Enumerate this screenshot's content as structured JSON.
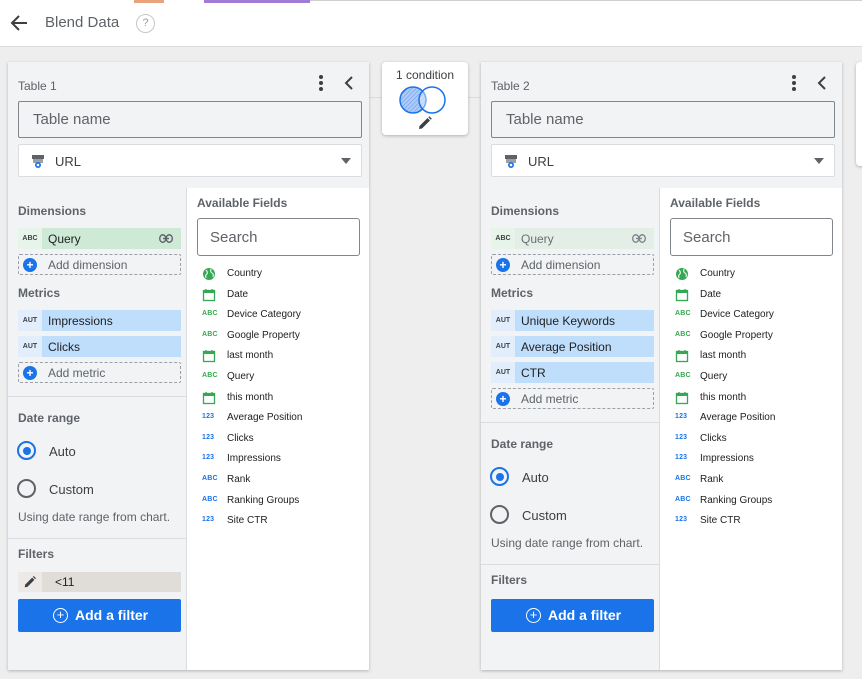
{
  "header": {
    "title": "Blend Data",
    "help": "?"
  },
  "colors": {
    "accent": "#1a73e8",
    "dimension": "#ceead6",
    "metric": "#bfdefc",
    "panel_bg": "#f1f3f4"
  },
  "condition": {
    "label": "1 condition"
  },
  "tables": [
    {
      "label": "Table 1",
      "name_placeholder": "Table name",
      "source": "URL",
      "dimensions_title": "Dimensions",
      "dimensions": [
        {
          "type": "ABC",
          "name": "Query"
        }
      ],
      "add_dimension": "Add dimension",
      "metrics_title": "Metrics",
      "metrics": [
        {
          "type": "AUT",
          "name": "Impressions"
        },
        {
          "type": "AUT",
          "name": "Clicks"
        }
      ],
      "add_metric": "Add metric",
      "date_range_title": "Date range",
      "date_auto": "Auto",
      "date_custom": "Custom",
      "date_selected": "Auto",
      "date_note": "Using date range from chart.",
      "filters_title": "Filters",
      "filters": [
        "<11"
      ],
      "add_filter": "Add a filter",
      "available_title": "Available Fields",
      "search_placeholder": "Search",
      "fields": [
        {
          "type": "geo",
          "name": "Country"
        },
        {
          "type": "date",
          "name": "Date"
        },
        {
          "type": "ABC",
          "name": "Device Category"
        },
        {
          "type": "ABC",
          "name": "Google Property"
        },
        {
          "type": "date",
          "name": "last month"
        },
        {
          "type": "ABC",
          "name": "Query"
        },
        {
          "type": "date",
          "name": "this month"
        },
        {
          "type": "123",
          "name": "Average Position"
        },
        {
          "type": "123",
          "name": "Clicks"
        },
        {
          "type": "123",
          "name": "Impressions"
        },
        {
          "type": "ABC",
          "name": "Rank"
        },
        {
          "type": "ABC",
          "name": "Ranking Groups"
        },
        {
          "type": "123",
          "name": "Site CTR"
        }
      ]
    },
    {
      "label": "Table 2",
      "name_placeholder": "Table name",
      "source": "URL",
      "dimensions_title": "Dimensions",
      "dimensions": [
        {
          "type": "ABC",
          "name": "Query"
        }
      ],
      "add_dimension": "Add dimension",
      "metrics_title": "Metrics",
      "metrics": [
        {
          "type": "AUT",
          "name": "Unique Keywords"
        },
        {
          "type": "AUT",
          "name": "Average Position"
        },
        {
          "type": "AUT",
          "name": "CTR"
        }
      ],
      "add_metric": "Add metric",
      "date_range_title": "Date range",
      "date_auto": "Auto",
      "date_custom": "Custom",
      "date_selected": "Auto",
      "date_note": "Using date range from chart.",
      "filters_title": "Filters",
      "filters": [],
      "add_filter": "Add a filter",
      "available_title": "Available Fields",
      "search_placeholder": "Search",
      "fields": [
        {
          "type": "geo",
          "name": "Country"
        },
        {
          "type": "date",
          "name": "Date"
        },
        {
          "type": "ABC",
          "name": "Device Category"
        },
        {
          "type": "ABC",
          "name": "Google Property"
        },
        {
          "type": "date",
          "name": "last month"
        },
        {
          "type": "ABC",
          "name": "Query"
        },
        {
          "type": "date",
          "name": "this month"
        },
        {
          "type": "123",
          "name": "Average Position"
        },
        {
          "type": "123",
          "name": "Clicks"
        },
        {
          "type": "123",
          "name": "Impressions"
        },
        {
          "type": "ABC",
          "name": "Rank"
        },
        {
          "type": "ABC",
          "name": "Ranking Groups"
        },
        {
          "type": "123",
          "name": "Site CTR"
        }
      ]
    }
  ]
}
